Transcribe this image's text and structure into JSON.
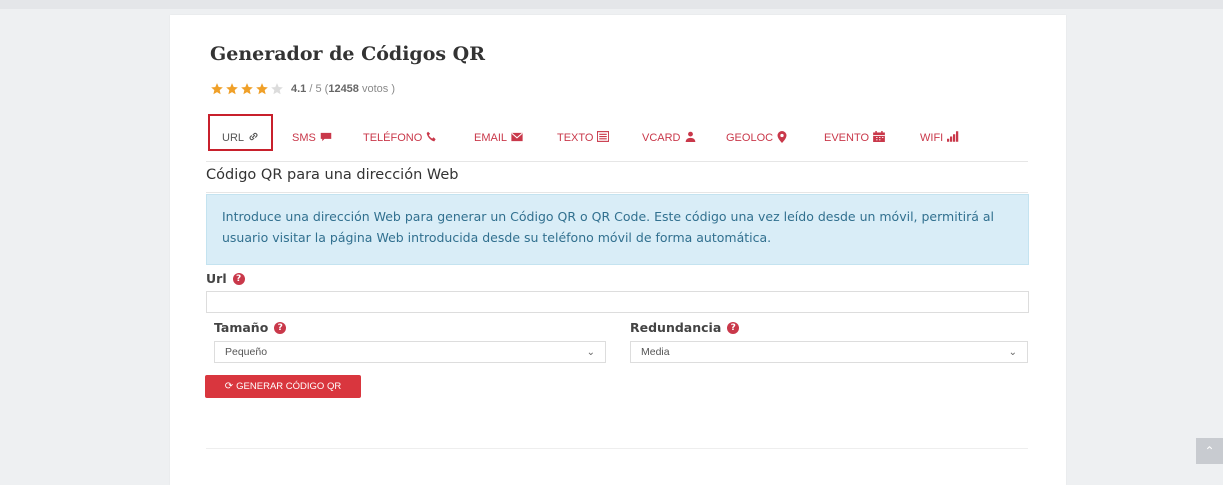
{
  "page": {
    "title": "Generador de Códigos QR",
    "rating": {
      "stars_value": 4.1,
      "stars_max": 5,
      "score": "4.1",
      "max_text": "/ 5",
      "votes_open": "(",
      "votes": "12458",
      "votes_label": "votos )"
    }
  },
  "tabs": [
    {
      "label": "URL",
      "icon": "link-icon",
      "active": true
    },
    {
      "label": "SMS",
      "icon": "chat-icon"
    },
    {
      "label": "TELÉFONO",
      "icon": "phone-icon"
    },
    {
      "label": "EMAIL",
      "icon": "envelope-icon"
    },
    {
      "label": "TEXTO",
      "icon": "list-icon"
    },
    {
      "label": "VCARD",
      "icon": "user-icon"
    },
    {
      "label": "GEOLOC",
      "icon": "map-marker-icon"
    },
    {
      "label": "EVENTO",
      "icon": "calendar-icon"
    },
    {
      "label": "WIFI",
      "icon": "signal-icon"
    }
  ],
  "section_title": "Código QR para una dirección Web",
  "info_text": "Introduce una dirección Web para generar un Código QR o QR Code. Este código una vez leído desde un móvil, permitirá al usuario visitar la página Web introducida desde su teléfono móvil de forma automática.",
  "form": {
    "url_label": "Url",
    "url_value": "",
    "size_label": "Tamaño",
    "size_value": "Pequeño",
    "redundancy_label": "Redundancia",
    "redundancy_value": "Media",
    "submit_label": "GENERAR CÓDIGO QR"
  },
  "colors": {
    "accent": "#c9384a",
    "button": "#d9363e",
    "star": "#f0a028",
    "info_bg": "#d9edf7"
  }
}
